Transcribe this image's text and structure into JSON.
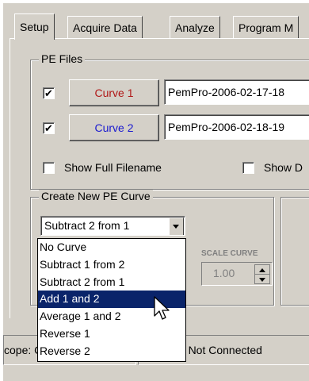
{
  "tabs": [
    {
      "label": "Setup",
      "active": true
    },
    {
      "label": "Acquire Data",
      "active": false
    },
    {
      "label": "Analyze",
      "active": false
    },
    {
      "label": "Program M",
      "active": false
    }
  ],
  "pe_files": {
    "legend": "PE Files",
    "curve1": {
      "checked": true,
      "button": "Curve 1",
      "filename": "PemPro-2006-02-17-18",
      "color": "#b01818"
    },
    "curve2": {
      "checked": true,
      "button": "Curve 2",
      "filename": "PemPro-2006-02-18-19",
      "color": "#1a1ad0"
    },
    "show_full_filename": "Show Full Filename",
    "show_d": "Show D"
  },
  "create_curve": {
    "legend": "Create New PE Curve",
    "selected": "Subtract 2 from 1",
    "scale_label": "SCALE CURVE",
    "scale_value": "1.00",
    "options": [
      "No Curve",
      "Subtract 1 from 2",
      "Subtract 2 from 1",
      "Add 1 and  2",
      "Average 1 and 2",
      "Reverse 1",
      "Reverse 2"
    ],
    "highlighted_index": 3
  },
  "status": {
    "scope": "cope: Connected",
    "camera": "Camera: Not Connected"
  }
}
